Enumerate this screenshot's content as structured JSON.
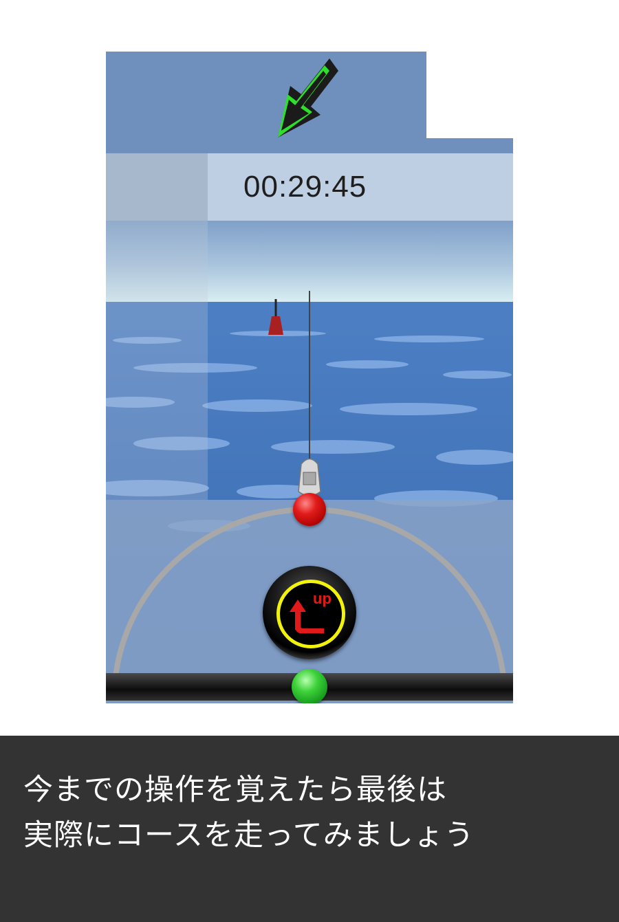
{
  "hud": {
    "timer": "00:29:45"
  },
  "controls": {
    "up_button_label": "up"
  },
  "caption": {
    "line1": "今までの操作を覚えたら最後は",
    "line2": "実際にコースを走ってみましょう"
  },
  "icons": {
    "direction_arrow": "down-left-arrow-icon",
    "up_button": "up-return-arrow-icon"
  },
  "colors": {
    "caption_background": "#333333",
    "arrow_accent": "#2ee02a",
    "rudder_knob": "#e21b1b",
    "throttle_knob": "#3ed23a",
    "up_ring": "#f2f20c"
  }
}
